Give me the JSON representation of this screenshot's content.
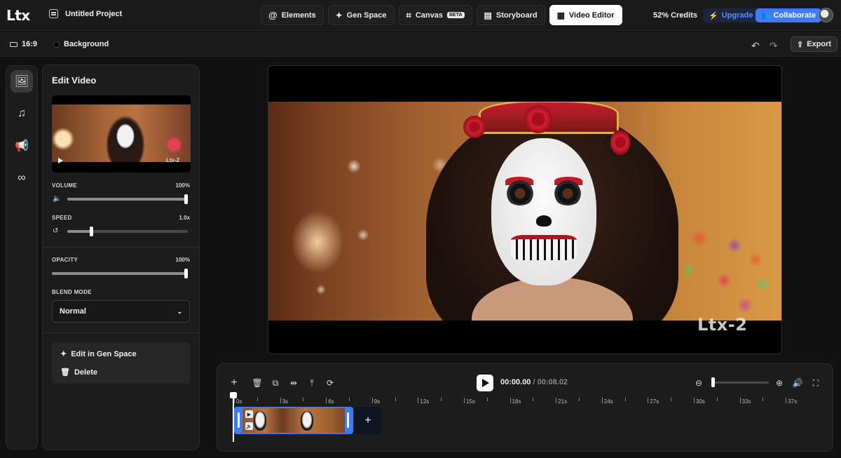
{
  "app": {
    "logo": "Ltx",
    "project_name": "Untitled Project"
  },
  "nav": {
    "tabs": [
      {
        "label": "Elements",
        "icon": "at-icon"
      },
      {
        "label": "Gen Space",
        "icon": "sparkle-icon"
      },
      {
        "label": "Canvas",
        "icon": "crop-icon",
        "badge": "BETA"
      },
      {
        "label": "Storyboard",
        "icon": "storyboard-icon"
      },
      {
        "label": "Video Editor",
        "icon": "film-icon",
        "active": true
      }
    ]
  },
  "account": {
    "credits": "52% Credits",
    "upgrade_label": "Upgrade",
    "collaborate_label": "Collaborate"
  },
  "toolbar": {
    "aspect_ratio": "16:9",
    "background_label": "Background",
    "export_label": "Export"
  },
  "panel": {
    "title": "Edit Video",
    "volume_label": "VOLUME",
    "volume_value": "100%",
    "volume_level": 1.0,
    "speed_label": "SPEED",
    "speed_value": "1.0x",
    "speed_level": 0.2,
    "opacity_label": "OPACITY",
    "opacity_value": "100%",
    "opacity_level": 1.0,
    "blend_mode_label": "BLEND MODE",
    "blend_mode_value": "Normal",
    "edit_in_gen_space": "Edit in Gen Space",
    "delete_label": "Delete",
    "thumbnail_watermark": "Ltx-2"
  },
  "preview": {
    "watermark": "Ltx-2"
  },
  "timeline": {
    "current_time": "00:00.00",
    "separator": "/",
    "duration": "00:08.02",
    "ruler_labels": [
      "0s",
      "3s",
      "6s",
      "9s",
      "12s",
      "15s",
      "18s",
      "21s",
      "24s",
      "27s",
      "30s",
      "33s",
      "37s"
    ],
    "add_label": "+"
  },
  "colors": {
    "accent": "#3e7bfa",
    "upgrade_text": "#5b8dff",
    "background": "#111111",
    "panel": "#1c1c1c"
  }
}
